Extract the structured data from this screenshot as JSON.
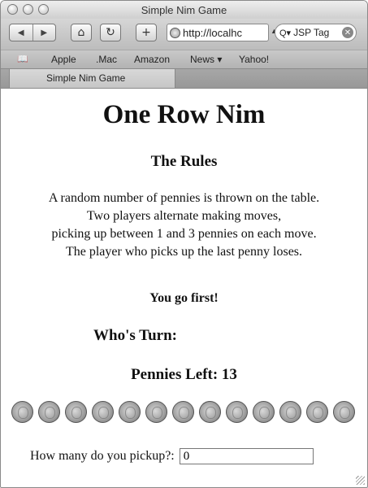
{
  "window": {
    "title": "Simple Nim Game"
  },
  "toolbar": {
    "back_icon": "back-arrow-icon",
    "forward_icon": "forward-arrow-icon",
    "home_symbol": "⌂",
    "reload_symbol": "↻",
    "add_symbol": "+",
    "url_value": "http://localhc",
    "search_value": "JSP Tag",
    "search_icon_glyph": "Q▾",
    "clear_symbol": "✕"
  },
  "bookmarks": {
    "book_glyph": "📖",
    "items": [
      "Apple",
      ".Mac",
      "Amazon",
      "News ▾",
      "Yahoo!"
    ]
  },
  "tab": {
    "label": "Simple Nim Game"
  },
  "page": {
    "title": "One Row Nim",
    "rules_heading": "The Rules",
    "rules_lines": [
      "A random number of pennies is thrown on the table.",
      "Two players alternate making moves,",
      "picking up between 1 and 3 pennies on each move.",
      "The player who picks up the last penny loses."
    ],
    "go_first": "You go first!",
    "whose_turn": "Who's Turn:",
    "pennies_left": "Pennies Left: 13",
    "penny_count": 13,
    "pickup_label": "How many do you pickup?:",
    "pickup_value": "0"
  }
}
